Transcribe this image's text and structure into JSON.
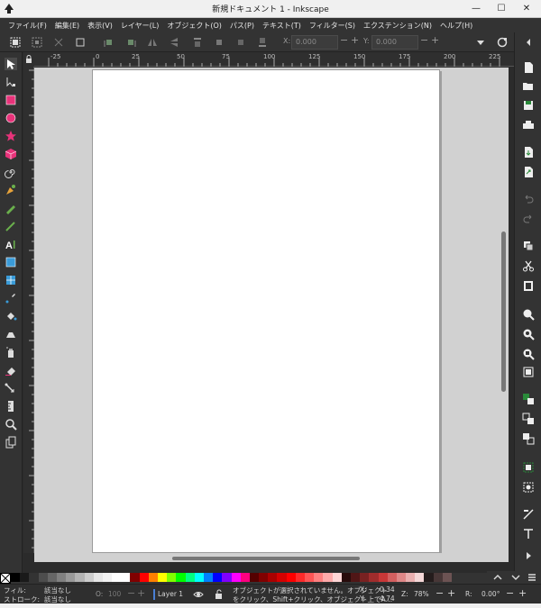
{
  "window": {
    "title": "新規ドキュメント 1 - Inkscape",
    "minimize_glyph": "—",
    "maximize_glyph": "☐",
    "close_glyph": "✕"
  },
  "menu": [
    "ファイル(F)",
    "編集(E)",
    "表示(V)",
    "レイヤー(L)",
    "オブジェクト(O)",
    "パス(P)",
    "テキスト(T)",
    "フィルター(S)",
    "エクステンション(N)",
    "ヘルプ(H)"
  ],
  "controls": {
    "x_label": "X:",
    "x_value": "0.000",
    "y_label": "Y:",
    "y_value": "0.000",
    "minus": "−",
    "plus": "+"
  },
  "ruler": {
    "top_labels": [
      "-25",
      "0",
      "25",
      "50",
      "75",
      "100",
      "125",
      "150",
      "175",
      "200",
      "225"
    ]
  },
  "palette": {
    "colors": [
      "#000000",
      "#1a1a1a",
      "#333333",
      "#4d4d4d",
      "#666666",
      "#808080",
      "#999999",
      "#b3b3b3",
      "#cccccc",
      "#e6e6e6",
      "#f2f2f2",
      "#ffffff",
      "#ffffff",
      "#800000",
      "#ff0000",
      "#ff8000",
      "#ffff00",
      "#80ff00",
      "#00ff00",
      "#00ff80",
      "#00ffff",
      "#0080ff",
      "#0000ff",
      "#8000ff",
      "#ff00ff",
      "#ff0080",
      "#550000",
      "#800000",
      "#aa0000",
      "#d40000",
      "#ff0000",
      "#ff2a2a",
      "#ff5555",
      "#ff8080",
      "#ffaaaa",
      "#ffd5d5",
      "#280b0b",
      "#501616",
      "#782121",
      "#a02c2c",
      "#c83737",
      "#d35f5f",
      "#de8787",
      "#e9afaf",
      "#f4d7d7",
      "#241c1c",
      "#483737",
      "#6c5353"
    ]
  },
  "status": {
    "fill_label": "フィル:",
    "fill_value": "該当なし",
    "stroke_label": "ストローク:",
    "stroke_value": "該当なし",
    "opacity_label": "O:",
    "opacity_value": "100",
    "layer_name": "Layer 1",
    "message_line1": "オブジェクトが選択されていません。オブジェクト",
    "message_line2": "をクリック、Shift+クリック、オブジェクト上でA…",
    "x_label": "X:",
    "x_value": "0.34",
    "y_label": "Y:",
    "y_value": "4.74",
    "zoom_label": "Z:",
    "zoom_value": "78%",
    "rotate_label": "R:",
    "rotate_value": "0.00°",
    "minus": "−",
    "plus": "+"
  }
}
